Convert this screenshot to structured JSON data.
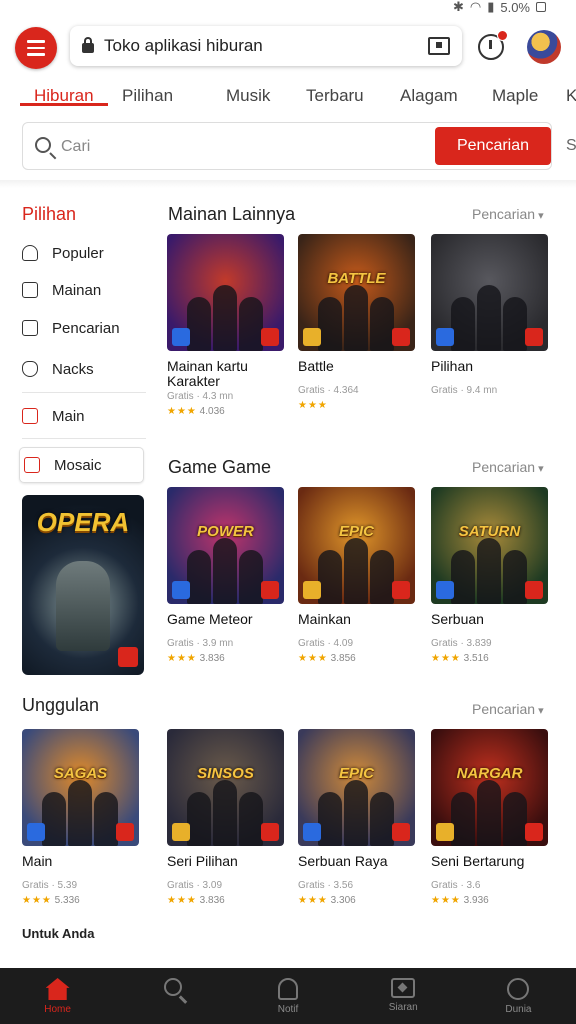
{
  "status": {
    "battery": "5.0%"
  },
  "header": {
    "url": "Toko aplikasi hiburan"
  },
  "nav_tabs": [
    "Hiburan",
    "Pilihan",
    "Musik",
    "Terbaru",
    "Alagam",
    "Maple",
    "K"
  ],
  "search": {
    "placeholder": "Cari",
    "button_label": "Pencarian",
    "extra": "S"
  },
  "sidebar": {
    "title": "Pilihan",
    "items": [
      "Populer",
      "Mainan",
      "Pencarian",
      "Nacks",
      "Main",
      "Mosaic"
    ],
    "promo_title": "OPERA",
    "section2_title": "Unggulan",
    "bottom_label": "Untuk Anda"
  },
  "sections": [
    {
      "title": "Mainan Lainnya",
      "more": "Pencarian",
      "cards": [
        {
          "name": "Mainan kartu Karakter",
          "meta": "Gratis · 4.3 mn",
          "stars": "★★★",
          "rating": "4.036",
          "colors": [
            "#3a1a6a",
            "#c23a2a"
          ]
        },
        {
          "name": "Battle",
          "meta": "Gratis · 4.364",
          "stars": "★★★",
          "rating": "",
          "colors": [
            "#3a2418",
            "#c55a1a"
          ],
          "art_title": "BATTLE"
        },
        {
          "name": "Pilihan",
          "meta": "Gratis · 9.4 mn",
          "stars": "",
          "rating": "",
          "colors": [
            "#2a2a2e",
            "#58585e"
          ]
        }
      ]
    },
    {
      "title": "Game Game",
      "more": "Pencarian",
      "cards": [
        {
          "name": "Game Meteor",
          "meta": "Gratis · 3.9 mn",
          "stars": "★★★",
          "rating": "3.836",
          "colors": [
            "#2a2a6a",
            "#c0346a"
          ],
          "art_title": "POWER"
        },
        {
          "name": "Mainkan",
          "meta": "Gratis · 4.09",
          "stars": "★★★",
          "rating": "3.856",
          "colors": [
            "#6a2a12",
            "#e0962a"
          ],
          "art_title": "EPIC"
        },
        {
          "name": "Serbuan",
          "meta": "Gratis · 3.839",
          "stars": "★★★",
          "rating": "3.516",
          "colors": [
            "#1e3a22",
            "#a88a3a"
          ],
          "art_title": "SATURN"
        }
      ]
    },
    {
      "title": "Unggulan",
      "more": "Pencarian",
      "cards": [
        {
          "name": "Main",
          "meta": "Gratis · 5.39",
          "stars": "★★★",
          "rating": "5.336",
          "colors": [
            "#3a4a7a",
            "#e08a2a"
          ],
          "art_title": "SAGAS"
        },
        {
          "name": "Seri Pilihan",
          "meta": "Gratis · 3.09",
          "stars": "★★★",
          "rating": "3.836",
          "colors": [
            "#2a2a3a",
            "#6a5a4a"
          ],
          "art_title": "SINSOS"
        },
        {
          "name": "Serbuan Raya",
          "meta": "Gratis · 3.56",
          "stars": "★★★",
          "rating": "3.306",
          "colors": [
            "#3a3a5a",
            "#d08a3a"
          ],
          "art_title": "EPIC"
        },
        {
          "name": "Seni Bertarung",
          "meta": "Gratis · 3.6",
          "stars": "★★★",
          "rating": "3.936",
          "colors": [
            "#3a0e0e",
            "#c0301e"
          ],
          "art_title": "NARGAR"
        }
      ]
    }
  ],
  "bottom_nav": [
    "Home",
    "",
    "Notif",
    "Siaran",
    "Dunia"
  ]
}
